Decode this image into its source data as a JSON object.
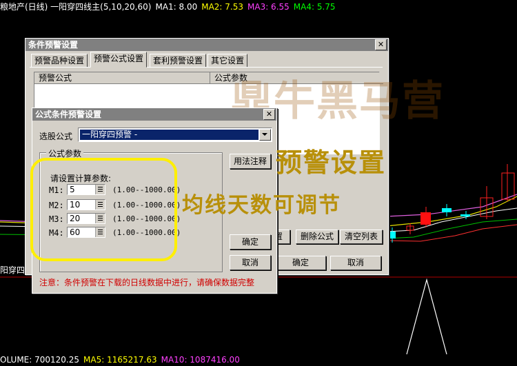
{
  "chart_header": {
    "title": "粮地产(日线) 一阳穿四线主(5,10,20,60)",
    "ma1": "MA1: 8.00",
    "ma2": "MA2: 7.53",
    "ma3": "MA3: 6.55",
    "ma4": "MA4: 5.75"
  },
  "chart_left_label": "阳穿四",
  "volume_bar": {
    "volume": "OLUME: 700120.25",
    "ma5": "MA5: 1165217.63",
    "ma10": "MA10: 1087416.00"
  },
  "outer_dialog": {
    "title": "条件预警设置",
    "tabs": [
      "预警品种设置",
      "预警公式设置",
      "套利预警设置",
      "其它设置"
    ],
    "active_tab": 1,
    "columns": [
      "预警公式",
      "公式参数"
    ],
    "buttons": {
      "edit_partial": "置",
      "delete": "删除公式",
      "clear": "清空列表",
      "ok": "确定",
      "cancel": "取消"
    }
  },
  "inner_dialog": {
    "title": "公式条件预警设置",
    "formula_label": "选股公式",
    "formula_value": "一阳穿四预警 -",
    "group_label": "公式参数",
    "usage_button": "用法注释",
    "prompt": "请设置计算参数:",
    "params": [
      {
        "name": "M1:",
        "value": "5",
        "range": "(1.00--1000.00)"
      },
      {
        "name": "M2:",
        "value": "10",
        "range": "(1.00--1000.00)"
      },
      {
        "name": "M3:",
        "value": "20",
        "range": "(1.00--1000.00)"
      },
      {
        "name": "M4:",
        "value": "60",
        "range": "(1.00--1000.00)"
      }
    ],
    "ok": "确定",
    "cancel": "取消",
    "note": "注意：条件预警在下载的日线数据中进行，请确保数据完整"
  },
  "annotations": {
    "watermark": "鼎牛黑马营",
    "heading": "预警设置",
    "subheading": "均线天数可调节"
  },
  "colors": {
    "ma1": "#ffffff",
    "ma2": "#ffff00",
    "ma3": "#ff00ff",
    "ma4": "#00ff00",
    "highlight": "#ffef00",
    "overlay_text": "#b8900a",
    "note_text": "#d00000"
  }
}
